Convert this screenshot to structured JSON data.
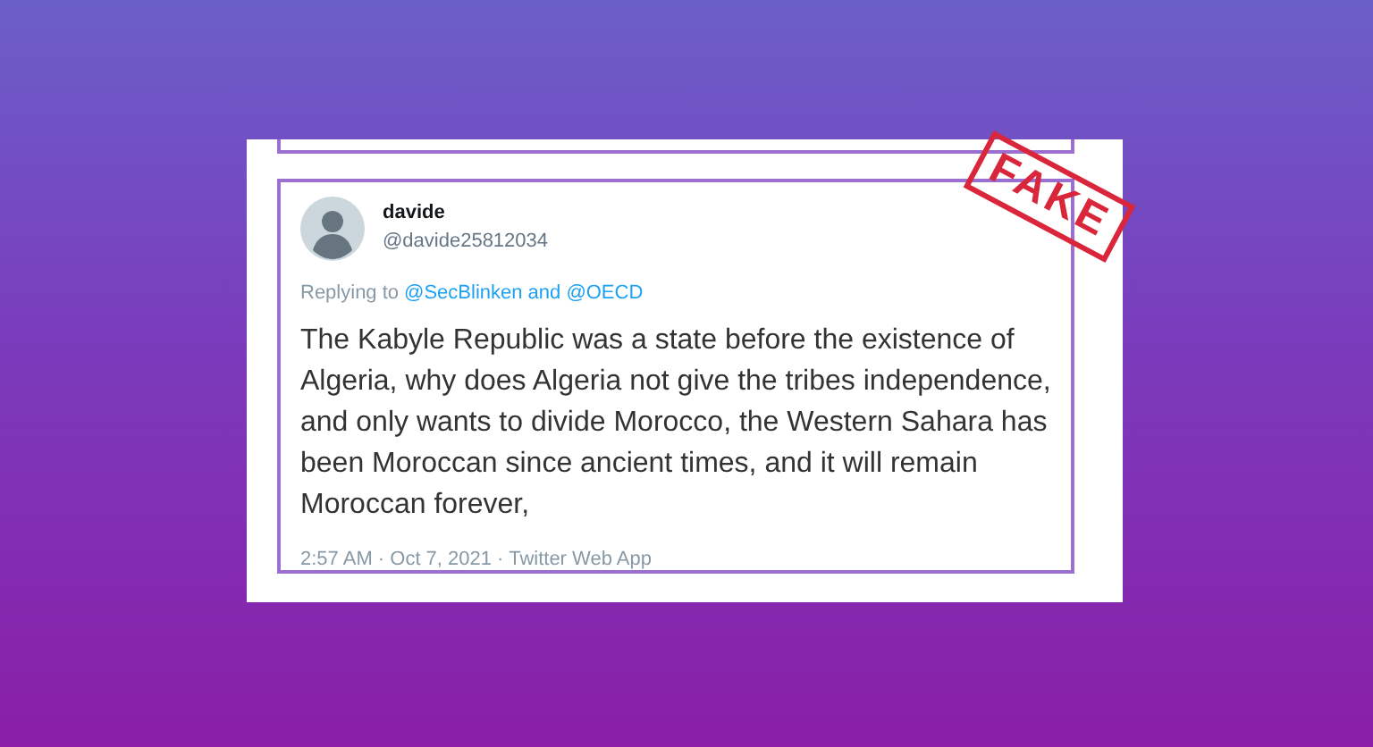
{
  "stamp": {
    "text": "FAKE"
  },
  "tweet": {
    "name": "davide",
    "handle": "@davide25812034",
    "replying_label": "Replying to",
    "mentions": "@SecBlinken and @OECD",
    "body": "The Kabyle Republic was a state before the existence of Algeria, why does Algeria not give the tribes independence, and only wants to divide Morocco, the Western Sahara has been Moroccan since ancient times, and it will remain Moroccan forever,",
    "meta": "2:57 AM · Oct 7, 2021 · Twitter Web App"
  }
}
